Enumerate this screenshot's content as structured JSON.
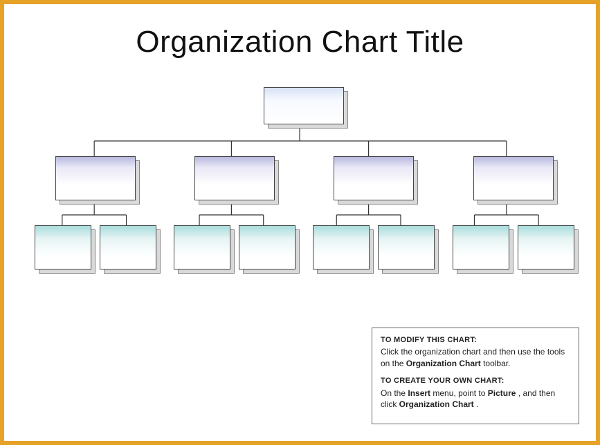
{
  "title": "Organization Chart Title",
  "info": {
    "modify_heading": "TO MODIFY THIS CHART:",
    "modify_prefix": "Click the organization chart and then use the tools on the ",
    "modify_bold": "Organization Chart",
    "modify_suffix": " toolbar.",
    "create_heading": "TO CREATE YOUR OWN CHART:",
    "create_prefix": "On the ",
    "create_bold1": "Insert",
    "create_mid1": " menu, point to ",
    "create_bold2": "Picture",
    "create_mid2": ", and then click ",
    "create_bold3": "Organization Chart",
    "create_suffix": "."
  },
  "chart_data": {
    "type": "tree",
    "layout": "hierarchy",
    "levels": [
      {
        "level": 0,
        "nodes": 1,
        "color": "light-blue"
      },
      {
        "level": 1,
        "nodes": 4,
        "color": "lavender"
      },
      {
        "level": 2,
        "nodes": 8,
        "color": "teal-light",
        "grouped_under_each_parent": 2
      }
    ],
    "node_labels": [],
    "title": "Organization Chart Title"
  }
}
